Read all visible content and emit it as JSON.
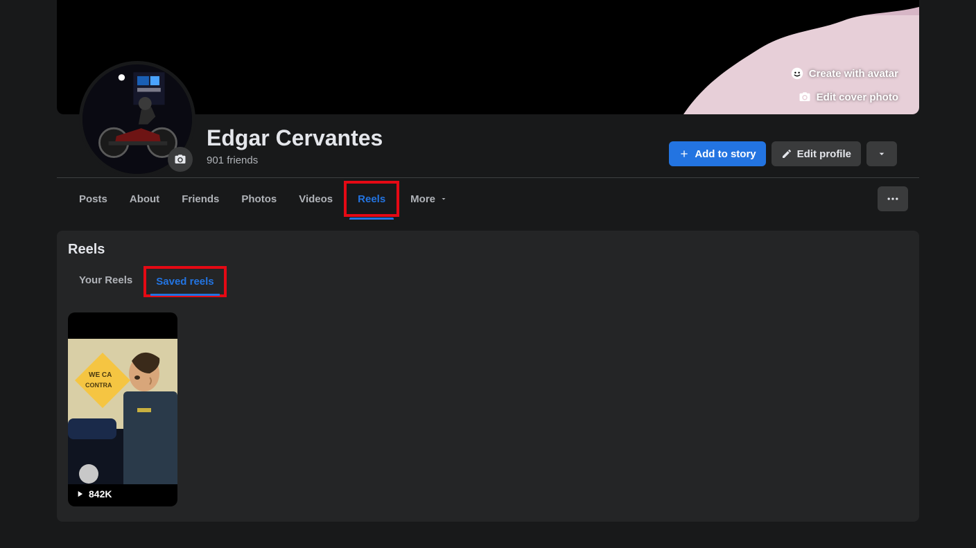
{
  "cover": {
    "create_avatar_label": "Create with avatar",
    "edit_cover_label": "Edit cover photo"
  },
  "profile": {
    "name": "Edgar Cervantes",
    "friends": "901 friends",
    "add_to_story": "Add to story",
    "edit_profile": "Edit profile"
  },
  "tabs": {
    "items": [
      {
        "label": "Posts"
      },
      {
        "label": "About"
      },
      {
        "label": "Friends"
      },
      {
        "label": "Photos"
      },
      {
        "label": "Videos"
      },
      {
        "label": "Reels"
      },
      {
        "label": "More"
      }
    ]
  },
  "reels_section": {
    "title": "Reels",
    "subtabs": [
      {
        "label": "Your Reels"
      },
      {
        "label": "Saved reels"
      }
    ],
    "items": [
      {
        "views": "842K"
      }
    ]
  }
}
